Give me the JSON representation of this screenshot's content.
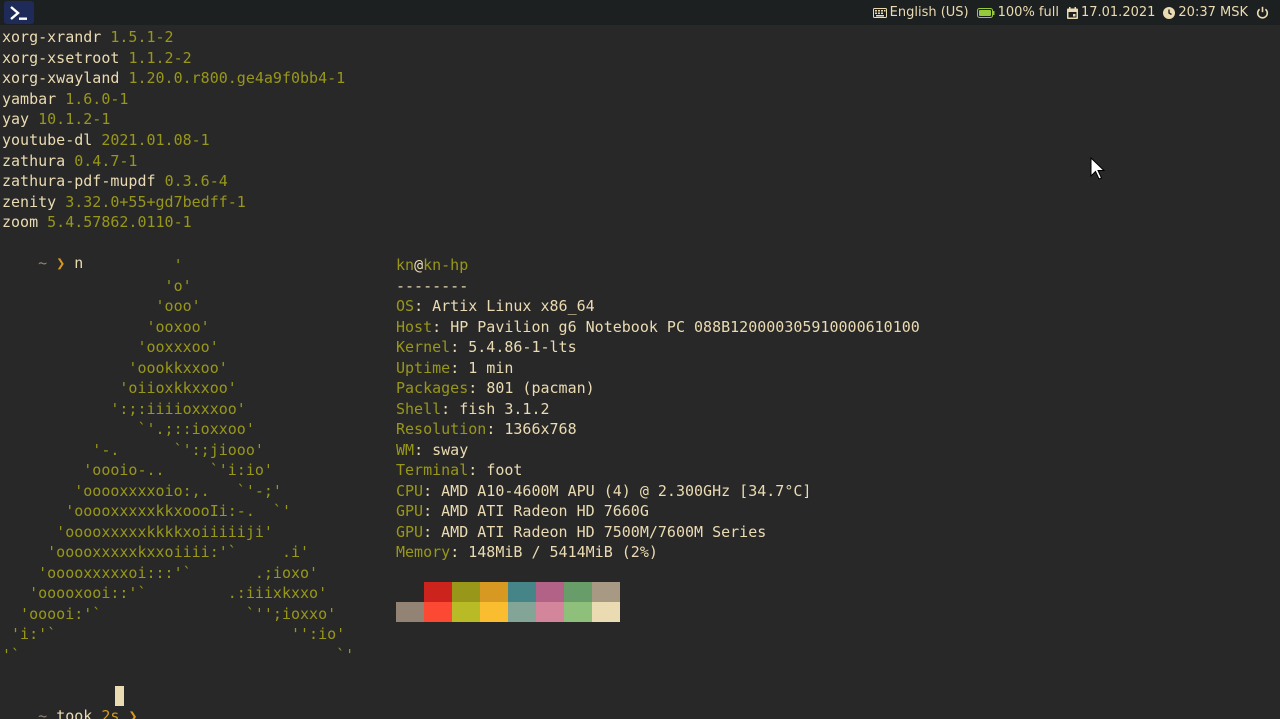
{
  "topbar": {
    "launcher_icon": "terminal-icon",
    "keyboard_layout": "English (US)",
    "battery": "100% full",
    "date": "17.01.2021",
    "time": "20:37 MSK",
    "icons": [
      "keyboard-icon",
      "battery-icon",
      "calendar-icon",
      "clock-icon",
      "power-icon"
    ],
    "colors": {
      "bar_bg": "#1d2021",
      "launcher_bg": "#1e2a57",
      "battery": "#98c93c"
    }
  },
  "packages": [
    {
      "name": "xorg-xrandr",
      "version": "1.5.1-2"
    },
    {
      "name": "xorg-xsetroot",
      "version": "1.1.2-2"
    },
    {
      "name": "xorg-xwayland",
      "version": "1.20.0.r800.ge4a9f0bb4-1"
    },
    {
      "name": "yambar",
      "version": "1.6.0-1"
    },
    {
      "name": "yay",
      "version": "10.1.2-1"
    },
    {
      "name": "youtube-dl",
      "version": "2021.01.08-1"
    },
    {
      "name": "zathura",
      "version": "0.4.7-1"
    },
    {
      "name": "zathura-pdf-mupdf",
      "version": "0.3.6-4"
    },
    {
      "name": "zenity",
      "version": "3.32.0+55+gd7bedff-1"
    },
    {
      "name": "zoom",
      "version": "5.4.57862.0110-1"
    }
  ],
  "prompt1": {
    "tilde": "~",
    "arrow": "❯",
    "command": "n"
  },
  "logo": [
    "                   '",
    "                  'o'",
    "                 'ooo'",
    "                'ooxoo'",
    "               'ooxxxoo'",
    "              'oookkxxoo'",
    "             'oiioxkkxxoo'",
    "            ':;:iiiioxxxoo'",
    "               `'.;::ioxxoo'",
    "          '-.      `':;jiooo'",
    "         'oooio-..     `'i:io'",
    "        'ooooxxxxoio:,.   `'-;'",
    "       'ooooxxxxxkkxoooIi:-.  `'",
    "      'ooooxxxxxkkkkxoiiiiiji'",
    "     'ooooxxxxxkxxoiiii:'`     .i'",
    "    'ooooxxxxxoi:::'`       .;ioxo'",
    "   'ooooxooi::'`         .:iiixkxxo'",
    "  'ooooi:'`                `'';ioxxo'",
    " 'i:'`                          '':io'",
    "'`                                   `'"
  ],
  "fetch": {
    "user": "kn",
    "at": "@",
    "host": "kn-hp",
    "separator": "--------",
    "fields": [
      {
        "key": "OS",
        "value": "Artix Linux x86_64"
      },
      {
        "key": "Host",
        "value": "HP Pavilion g6 Notebook PC 088B120000305910000610100"
      },
      {
        "key": "Kernel",
        "value": "5.4.86-1-lts"
      },
      {
        "key": "Uptime",
        "value": "1 min"
      },
      {
        "key": "Packages",
        "value": "801 (pacman)"
      },
      {
        "key": "Shell",
        "value": "fish 3.1.2"
      },
      {
        "key": "Resolution",
        "value": "1366x768"
      },
      {
        "key": "WM",
        "value": "sway"
      },
      {
        "key": "Terminal",
        "value": "foot"
      },
      {
        "key": "CPU",
        "value": "AMD A10-4600M APU (4) @ 2.300GHz [34.7°C]"
      },
      {
        "key": "GPU",
        "value": "AMD ATI Radeon HD 7660G"
      },
      {
        "key": "GPU",
        "value": "AMD ATI Radeon HD 7500M/7600M Series"
      },
      {
        "key": "Memory",
        "value": "148MiB / 5414MiB (2%)"
      }
    ],
    "palette_dark": [
      "#282828",
      "#cc241d",
      "#98971a",
      "#d79921",
      "#458588",
      "#b16286",
      "#689d6a",
      "#a89984"
    ],
    "palette_bright": [
      "#928374",
      "#fb4934",
      "#b8bb26",
      "#fabd2f",
      "#83a598",
      "#d3869b",
      "#8ec07c",
      "#ebdbb2"
    ]
  },
  "prompt2": {
    "tilde": "~",
    "took": "took",
    "duration": "2s",
    "arrow": "❯"
  }
}
